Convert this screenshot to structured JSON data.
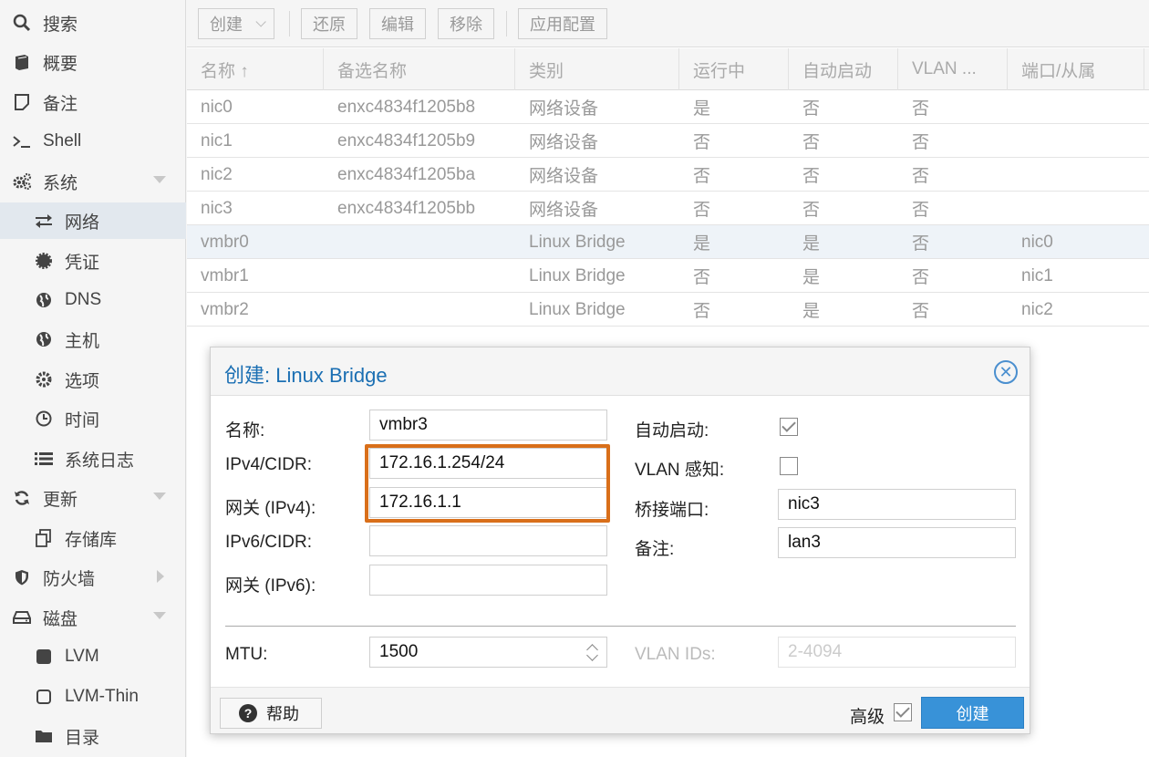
{
  "sidebar": {
    "items": [
      {
        "label": "搜索",
        "icon": "search-icon"
      },
      {
        "label": "概要",
        "icon": "book-icon"
      },
      {
        "label": "备注",
        "icon": "note-icon"
      },
      {
        "label": "Shell",
        "icon": "terminal-icon"
      },
      {
        "label": "系统",
        "icon": "gears-icon"
      },
      {
        "label": "网络",
        "icon": "exchange-icon"
      },
      {
        "label": "凭证",
        "icon": "certificate-icon"
      },
      {
        "label": "DNS",
        "icon": "globe-icon"
      },
      {
        "label": "主机",
        "icon": "globe-icon"
      },
      {
        "label": "选项",
        "icon": "gear-icon"
      },
      {
        "label": "时间",
        "icon": "clock-icon"
      },
      {
        "label": "系统日志",
        "icon": "list-icon"
      },
      {
        "label": "更新",
        "icon": "refresh-icon"
      },
      {
        "label": "存储库",
        "icon": "files-icon"
      },
      {
        "label": "防火墙",
        "icon": "shield-icon"
      },
      {
        "label": "磁盘",
        "icon": "hdd-icon"
      },
      {
        "label": "LVM",
        "icon": "square-icon"
      },
      {
        "label": "LVM-Thin",
        "icon": "square-outline-icon"
      },
      {
        "label": "目录",
        "icon": "folder-icon"
      }
    ]
  },
  "toolbar": {
    "create": "创建",
    "revert": "还原",
    "edit": "编辑",
    "remove": "移除",
    "apply": "应用配置"
  },
  "grid": {
    "headers": [
      "名称 ↑",
      "备选名称",
      "类别",
      "运行中",
      "自动启动",
      "VLAN ...",
      "端口/从属"
    ],
    "rows": [
      [
        "nic0",
        "enxc4834f1205b8",
        "网络设备",
        "是",
        "否",
        "否",
        ""
      ],
      [
        "nic1",
        "enxc4834f1205b9",
        "网络设备",
        "否",
        "否",
        "否",
        ""
      ],
      [
        "nic2",
        "enxc4834f1205ba",
        "网络设备",
        "否",
        "否",
        "否",
        ""
      ],
      [
        "nic3",
        "enxc4834f1205bb",
        "网络设备",
        "否",
        "否",
        "否",
        ""
      ],
      [
        "vmbr0",
        "",
        "Linux Bridge",
        "是",
        "是",
        "否",
        "nic0"
      ],
      [
        "vmbr1",
        "",
        "Linux Bridge",
        "否",
        "是",
        "否",
        "nic1"
      ],
      [
        "vmbr2",
        "",
        "Linux Bridge",
        "否",
        "是",
        "否",
        "nic2"
      ]
    ]
  },
  "dialog": {
    "title_prefix": "创建:",
    "title_name": "Linux Bridge",
    "name_label": "名称:",
    "name_value": "vmbr3",
    "ipv4_label": "IPv4/CIDR:",
    "ipv4_value": "172.16.1.254/24",
    "gw4_label": "网关 (IPv4):",
    "gw4_value": "172.16.1.1",
    "ipv6_label": "IPv6/CIDR:",
    "ipv6_value": "",
    "gw6_label": "网关 (IPv6):",
    "gw6_value": "",
    "autostart_label": "自动启动:",
    "autostart_checked": true,
    "vlan_aware_label": "VLAN 感知:",
    "vlan_aware_checked": false,
    "bridge_ports_label": "桥接端口:",
    "bridge_ports_value": "nic3",
    "comment_label": "备注:",
    "comment_value": "lan3",
    "mtu_label": "MTU:",
    "mtu_value": "1500",
    "vlan_ids_label": "VLAN IDs:",
    "vlan_ids_placeholder": "2-4094",
    "help": "帮助",
    "advanced": "高级",
    "advanced_checked": true,
    "create": "创建"
  },
  "colors": {
    "accent": "#3892d8",
    "highlight_box": "#d96f1a",
    "title_blue": "#1b6fb3"
  }
}
